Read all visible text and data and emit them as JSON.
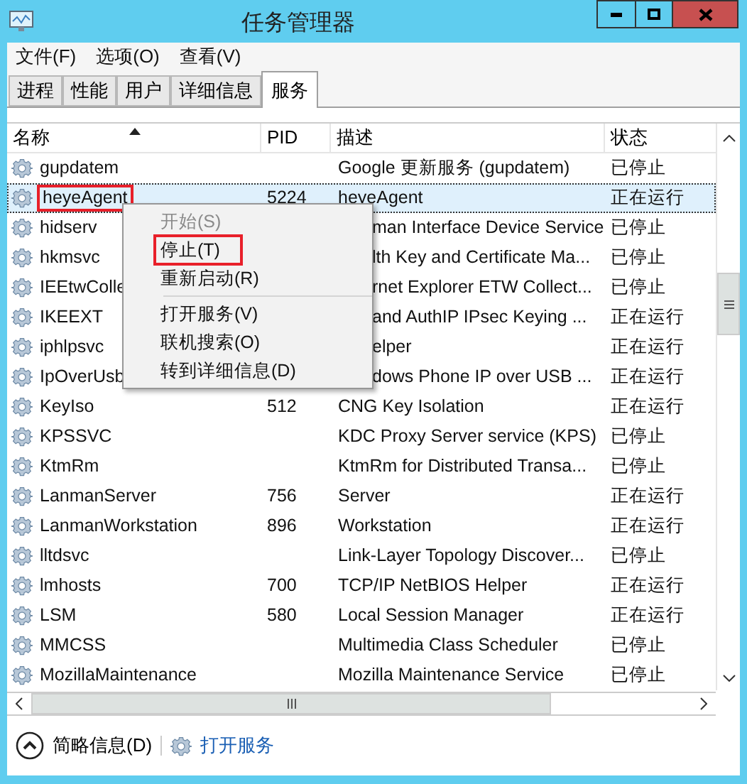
{
  "window": {
    "title": "任务管理器"
  },
  "menu_bar": [
    "文件(F)",
    "选项(O)",
    "查看(V)"
  ],
  "tabs": [
    {
      "label": "进程",
      "selected": false
    },
    {
      "label": "性能",
      "selected": false
    },
    {
      "label": "用户",
      "selected": false
    },
    {
      "label": "详细信息",
      "selected": false
    },
    {
      "label": "服务",
      "selected": true
    }
  ],
  "table": {
    "columns": [
      "名称",
      "PID",
      "描述",
      "状态"
    ],
    "rows": [
      {
        "name": "gupdatem",
        "pid": "",
        "description": "Google 更新服务 (gupdatem)",
        "status": "已停止",
        "selected": false,
        "covered": false,
        "marked": false
      },
      {
        "name": "heyeAgent",
        "pid": "5224",
        "description": "heyeAgent",
        "status": "正在运行",
        "selected": true,
        "covered": false,
        "marked": true
      },
      {
        "name": "hidserv",
        "pid": "",
        "description": "man Interface Device Service",
        "status": "已停止",
        "selected": false,
        "covered": true,
        "marked": false
      },
      {
        "name": "hkmsvc",
        "pid": "",
        "description": "lth Key and Certificate Ma...",
        "status": "已停止",
        "selected": false,
        "covered": true,
        "marked": false
      },
      {
        "name": "IEEtwColle",
        "pid": "",
        "description": "rnet Explorer ETW Collect...",
        "status": "已停止",
        "selected": false,
        "covered": true,
        "marked": false
      },
      {
        "name": "IKEEXT",
        "pid": "",
        "description": "and AuthIP IPsec Keying ...",
        "status": "正在运行",
        "selected": false,
        "covered": true,
        "marked": false
      },
      {
        "name": "iphlpsvc",
        "pid": "",
        "description": "elper",
        "status": "正在运行",
        "selected": false,
        "covered": true,
        "marked": false
      },
      {
        "name": "IpOverUsb",
        "pid": "",
        "description": "dows Phone IP over USB ...",
        "status": "正在运行",
        "selected": false,
        "covered": true,
        "marked": false
      },
      {
        "name": "KeyIso",
        "pid": "512",
        "description": "CNG Key Isolation",
        "status": "正在运行",
        "selected": false,
        "covered": false,
        "marked": false
      },
      {
        "name": "KPSSVC",
        "pid": "",
        "description": "KDC Proxy Server service (KPS)",
        "status": "已停止",
        "selected": false,
        "covered": false,
        "marked": false
      },
      {
        "name": "KtmRm",
        "pid": "",
        "description": "KtmRm for Distributed Transa...",
        "status": "已停止",
        "selected": false,
        "covered": false,
        "marked": false
      },
      {
        "name": "LanmanServer",
        "pid": "756",
        "description": "Server",
        "status": "正在运行",
        "selected": false,
        "covered": false,
        "marked": false
      },
      {
        "name": "LanmanWorkstation",
        "pid": "896",
        "description": "Workstation",
        "status": "正在运行",
        "selected": false,
        "covered": false,
        "marked": false
      },
      {
        "name": "lltdsvc",
        "pid": "",
        "description": "Link-Layer Topology Discover...",
        "status": "已停止",
        "selected": false,
        "covered": false,
        "marked": false
      },
      {
        "name": "lmhosts",
        "pid": "700",
        "description": "TCP/IP NetBIOS Helper",
        "status": "正在运行",
        "selected": false,
        "covered": false,
        "marked": false
      },
      {
        "name": "LSM",
        "pid": "580",
        "description": "Local Session Manager",
        "status": "正在运行",
        "selected": false,
        "covered": false,
        "marked": false
      },
      {
        "name": "MMCSS",
        "pid": "",
        "description": "Multimedia Class Scheduler",
        "status": "已停止",
        "selected": false,
        "covered": false,
        "marked": false
      },
      {
        "name": "MozillaMaintenance",
        "pid": "",
        "description": "Mozilla Maintenance Service",
        "status": "已停止",
        "selected": false,
        "covered": false,
        "marked": false
      }
    ]
  },
  "context_menu": {
    "items": [
      {
        "kind": "item",
        "label": "开始(S)",
        "disabled": true,
        "marked": false
      },
      {
        "kind": "item",
        "label": "停止(T)",
        "disabled": false,
        "marked": true
      },
      {
        "kind": "item",
        "label": "重新启动(R)",
        "disabled": false,
        "marked": false
      },
      {
        "kind": "separator"
      },
      {
        "kind": "item",
        "label": "打开服务(V)",
        "disabled": false,
        "marked": false
      },
      {
        "kind": "item",
        "label": "联机搜索(O)",
        "disabled": false,
        "marked": false
      },
      {
        "kind": "item",
        "label": "转到详细信息(D)",
        "disabled": false,
        "marked": false
      }
    ]
  },
  "footer": {
    "details_toggle": "简略信息(D)",
    "open_services": "打开服务"
  }
}
